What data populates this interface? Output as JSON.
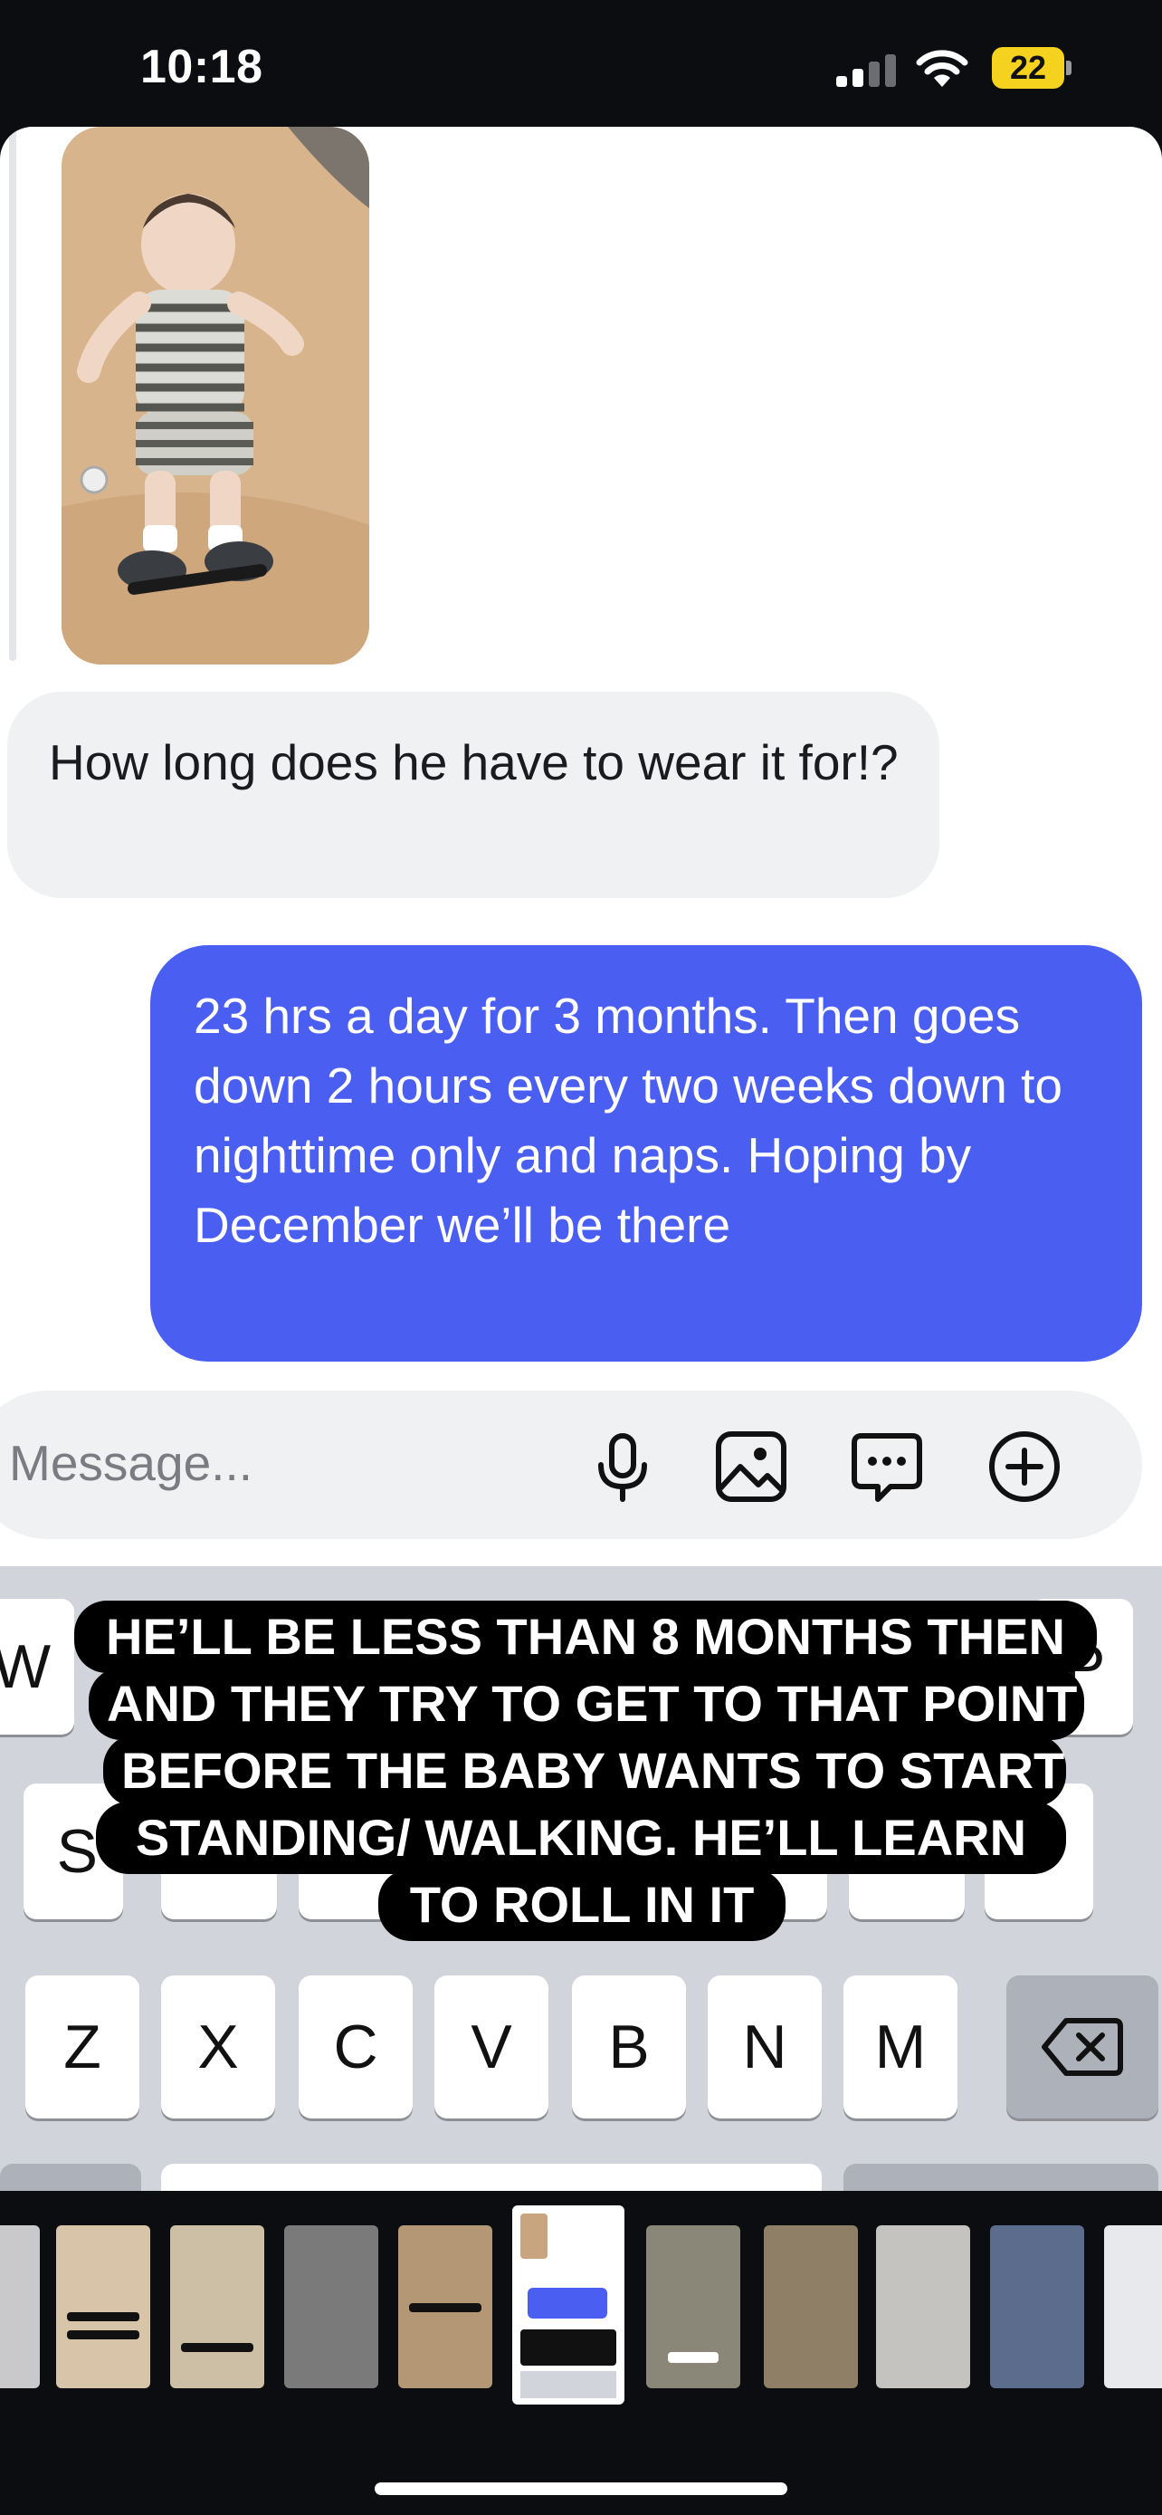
{
  "status_bar": {
    "time": "10:18",
    "battery_level": "22",
    "icons": [
      "cellular-signal-icon",
      "wifi-icon",
      "battery-icon"
    ]
  },
  "chat": {
    "shared_photo_icon": "photo-thumbnail",
    "messages": [
      {
        "direction": "incoming",
        "text": "How long does he have to wear it for!?"
      },
      {
        "direction": "outgoing",
        "text": "23 hrs a day for 3 months. Then goes down 2 hours every two weeks down to nighttime only and naps. Hoping by December we’ll be there"
      }
    ],
    "outgoing_bubble_color": "#4a5ff2",
    "incoming_bubble_color": "#f0f1f3"
  },
  "composer": {
    "placeholder": "Message...",
    "icons": [
      "microphone-icon",
      "image-icon",
      "sticker-chat-icon",
      "plus-circle-icon"
    ]
  },
  "keyboard": {
    "row1_visible": [
      "W",
      "P"
    ],
    "row2_visible": [
      "S"
    ],
    "row3": [
      "Z",
      "X",
      "C",
      "V",
      "B",
      "N",
      "M"
    ],
    "delete_icon": "backspace-icon"
  },
  "caption_lines": [
    "HE’LL BE LESS THAN 8 MONTHS THEN",
    "AND THEY TRY TO GET TO THAT POINT",
    "BEFORE THE BABY WANTS TO START",
    "STANDING/ WALKING. HE’LL LEARN",
    "TO ROLL IN IT"
  ],
  "filmstrip": {
    "thumbnail_count": 12,
    "active_index": 6
  }
}
